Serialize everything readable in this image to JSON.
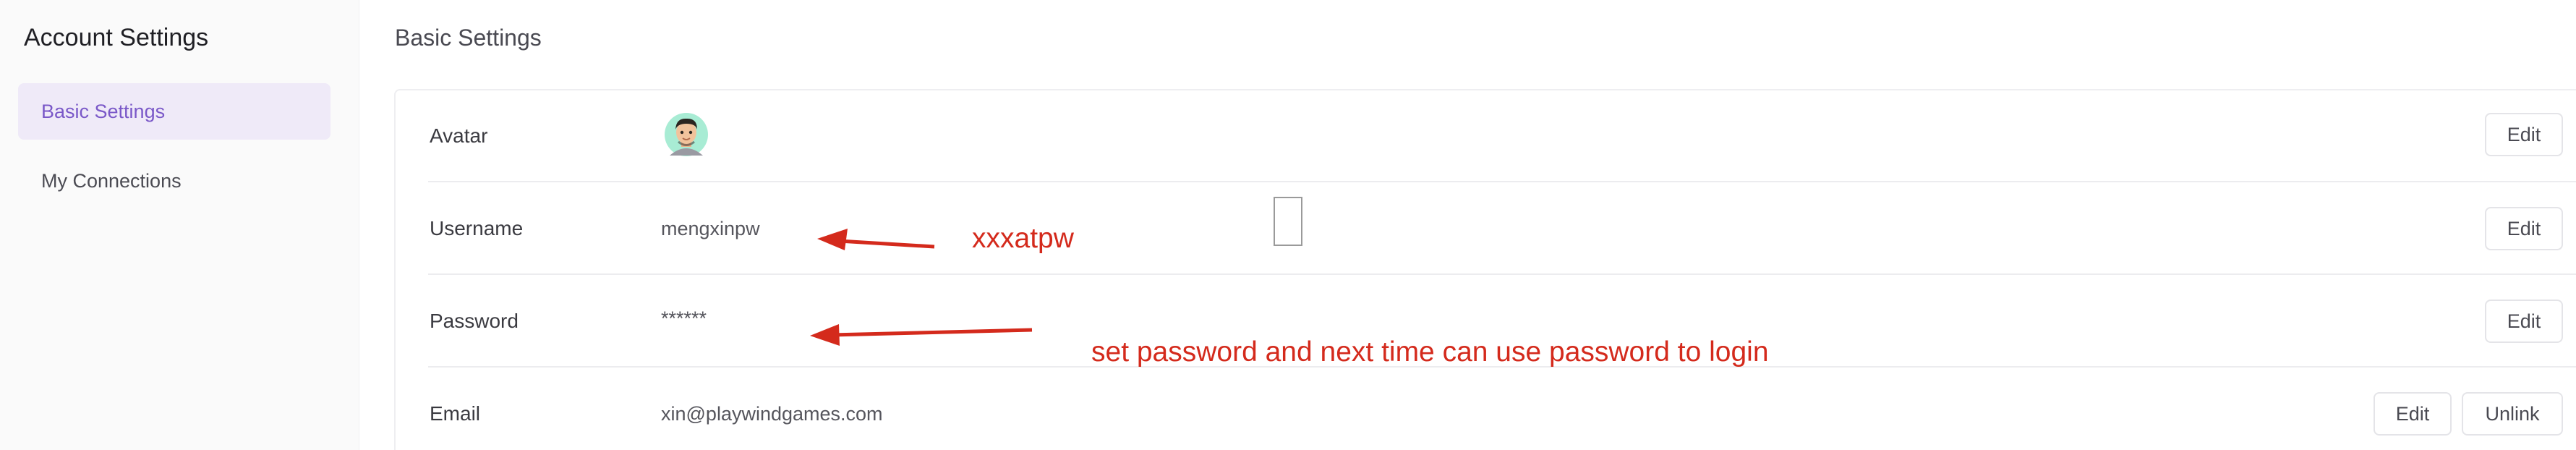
{
  "sidebar": {
    "title": "Account Settings",
    "items": [
      {
        "label": "Basic Settings",
        "active": true
      },
      {
        "label": "My Connections",
        "active": false
      }
    ]
  },
  "main": {
    "title": "Basic Settings",
    "rows": [
      {
        "label": "Avatar",
        "value": "",
        "buttons": [
          "Edit"
        ]
      },
      {
        "label": "Username",
        "value": "mengxinpw",
        "buttons": [
          "Edit"
        ]
      },
      {
        "label": "Password",
        "value": "******",
        "buttons": [
          "Edit"
        ]
      },
      {
        "label": "Email",
        "value": "xin@playwindgames.com",
        "buttons": [
          "Edit",
          "Unlink"
        ]
      }
    ]
  },
  "annotations": {
    "username_note": "xxxatpw",
    "password_note": "set password and next time can use password to login"
  },
  "colors": {
    "accent": "#7a58c8",
    "active_bg": "#efeaf8",
    "annotation": "#d42a1c",
    "sidebar_bg": "#fafafa",
    "border": "#eeeef1"
  },
  "icons": {
    "avatar": "memoji-avatar-icon",
    "arrow": "red-arrow-annotation"
  }
}
